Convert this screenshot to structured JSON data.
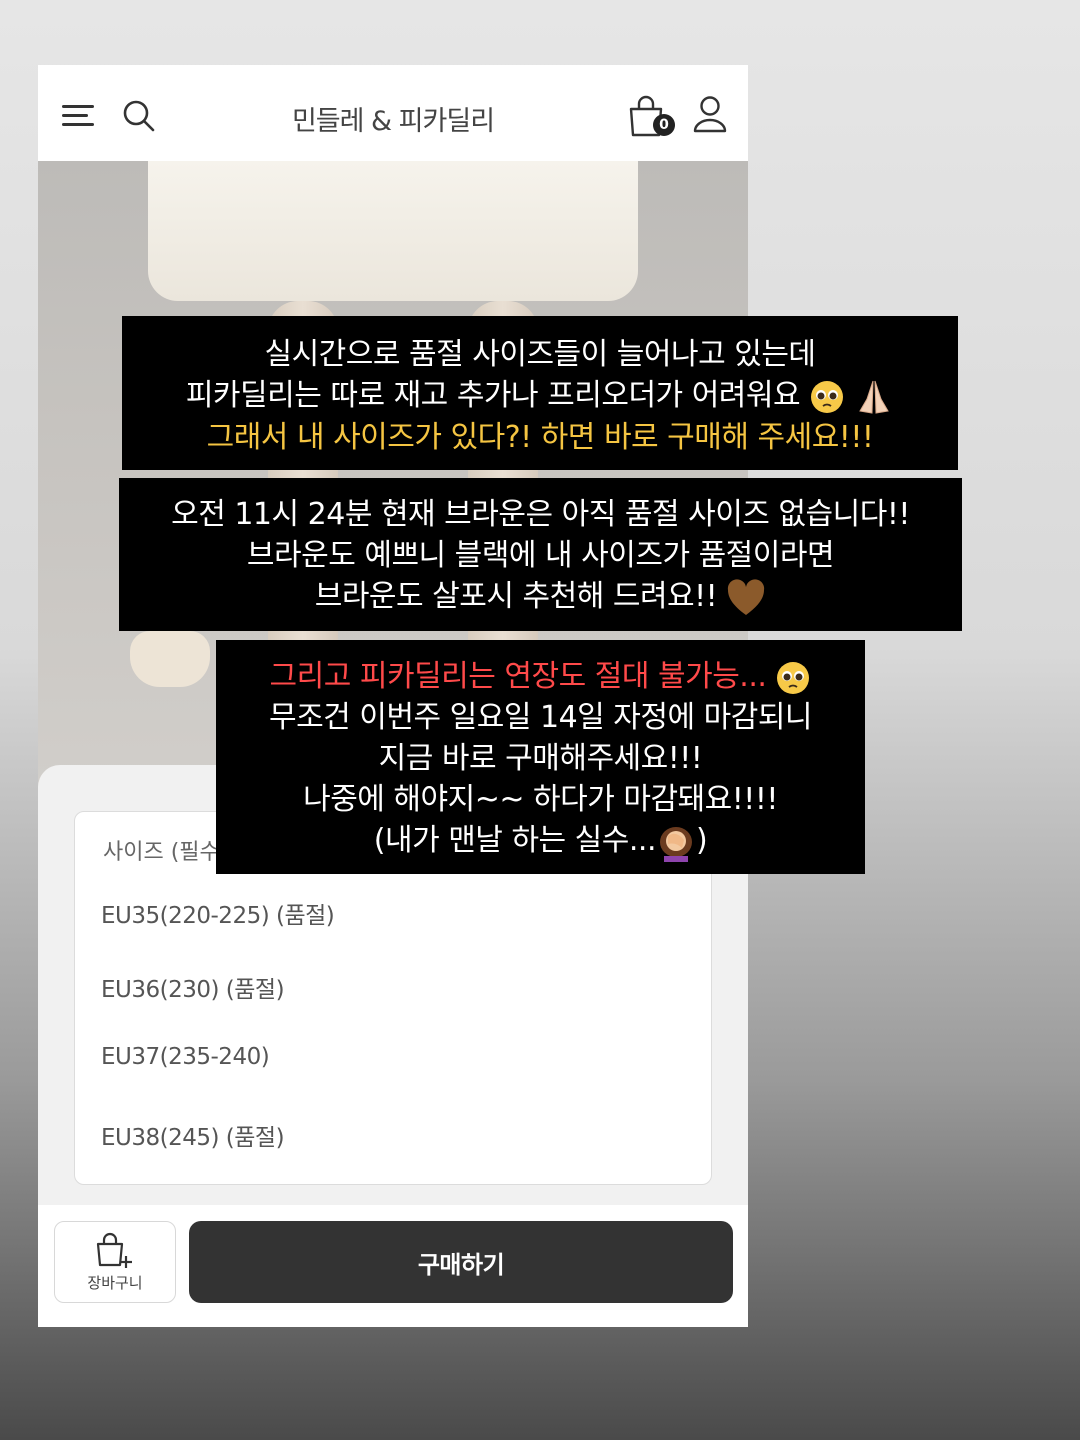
{
  "header": {
    "store_title": "민들레 & 피카딜리",
    "cart_count": "0"
  },
  "options": {
    "label": "사이즈 (필수",
    "items": [
      "EU35(220-225) (품절)",
      "EU36(230) (품절)",
      "EU37(235-240)",
      "EU38(245) (품절)"
    ]
  },
  "bottom": {
    "cart_label": "장바구니",
    "buy_label": "구매하기"
  },
  "captions": {
    "box1": {
      "line1": "실시간으로 품절 사이즈들이 늘어나고 있는데",
      "line2": "피카딜리는 따로 재고 추가나 프리오더가 어려워요",
      "line3": "그래서 내 사이즈가 있다?! 하면 바로 구매해 주세요!!!"
    },
    "box2": {
      "line1": "오전 11시 24분 현재 브라운은 아직 품절 사이즈 없습니다!!",
      "line2": "브라운도 예쁘니 블랙에 내 사이즈가 품절이라면",
      "line3": "브라운도 살포시 추천해 드려요!!"
    },
    "box3": {
      "line1": "그리고 피카딜리는 연장도 절대 불가능...",
      "line2": "무조건 이번주 일요일 14일 자정에 마감되니",
      "line3": "지금 바로 구매해주세요!!!",
      "line4": "나중에 해야지~~ 하다가 마감돼요!!!!",
      "line5a": "(내가 맨날 하는 실수...",
      "line5b": ")"
    }
  },
  "colors": {
    "highlight_yellow": "#f5c542",
    "highlight_red": "#ff4a4a",
    "buy_button": "#333333"
  },
  "icons": [
    "menu-icon",
    "search-icon",
    "shopping-bag-icon",
    "user-icon",
    "cart-plus-icon",
    "pleading-face-emoji",
    "praying-hands-emoji",
    "brown-heart-emoji",
    "facepalm-emoji"
  ]
}
